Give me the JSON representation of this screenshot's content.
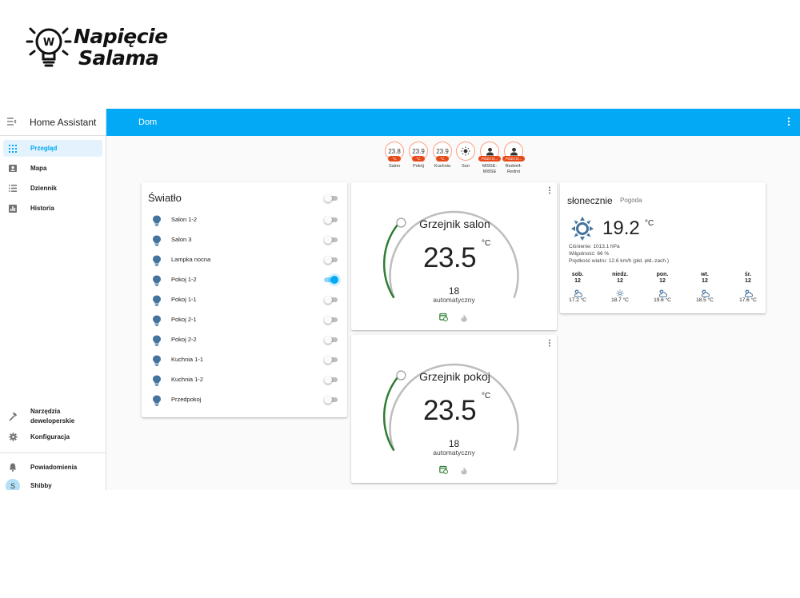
{
  "logo": {
    "line1": "Napięcie",
    "line2": "Salama",
    "mark": "W"
  },
  "sidebar": {
    "title": "Home Assistant",
    "items": [
      {
        "label": "Przegląd",
        "icon": "grid-icon",
        "active": true
      },
      {
        "label": "Mapa",
        "icon": "map-icon"
      },
      {
        "label": "Dziennik",
        "icon": "list-icon"
      },
      {
        "label": "Historia",
        "icon": "chart-icon"
      }
    ],
    "bottom": [
      {
        "label": "Narzędzia",
        "label2": "deweloperskie",
        "icon": "hammer-icon"
      },
      {
        "label": "Konfiguracja",
        "icon": "gear-icon"
      },
      {
        "label": "Powiadomienia",
        "icon": "bell-icon"
      }
    ],
    "user": {
      "initial": "S",
      "name": "Shibby"
    }
  },
  "header": {
    "title": "Dom"
  },
  "badges": [
    {
      "value": "23.8",
      "unit": "°C",
      "name": "Salon"
    },
    {
      "value": "23.9",
      "unit": "°C",
      "name": "Pokój"
    },
    {
      "value": "23.9",
      "unit": "°C",
      "name": "Kuchnia"
    },
    {
      "name": "Sun",
      "icon": "sun-icon"
    },
    {
      "unit": "POZA D...",
      "name": "MI9SE-",
      "name2": "MI9SE",
      "icon": "person-icon"
    },
    {
      "unit": "POZA D...",
      "name": "Redmi4-",
      "name2": "Redmi",
      "icon": "person-icon"
    }
  ],
  "lights": {
    "title": "Światło",
    "master_on": false,
    "items": [
      {
        "name": "Salon 1-2",
        "on": false
      },
      {
        "name": "Salon 3",
        "on": false
      },
      {
        "name": "Lampka nocna",
        "on": false
      },
      {
        "name": "Pokoj 1-2",
        "on": true
      },
      {
        "name": "Pokoj 1-1",
        "on": false
      },
      {
        "name": "Pokoj 2-1",
        "on": false
      },
      {
        "name": "Pokoj 2-2",
        "on": false
      },
      {
        "name": "Kuchnia 1-1",
        "on": false
      },
      {
        "name": "Kuchnia 1-2",
        "on": false
      },
      {
        "name": "Przedpokoj",
        "on": false
      }
    ]
  },
  "thermostats": [
    {
      "name": "Grzejnik salon",
      "temp": "23.5",
      "unit": "°C",
      "target": "18",
      "mode": "automatyczny"
    },
    {
      "name": "Grzejnik pokoj",
      "temp": "23.5",
      "unit": "°C",
      "target": "18",
      "mode": "automatyczny"
    }
  ],
  "weather": {
    "state": "słonecznie",
    "name": "Pogoda",
    "temp": "19.2",
    "unit": "°C",
    "pressure": "Ciśnienie: 1013.1 hPa",
    "humidity": "Wilgotność: 66 %",
    "wind": "Prędkość wiatru: 12.6 km/h (płd. płd.-zach.)",
    "forecast": [
      {
        "day": "sob.",
        "date": "12",
        "temp": "17.2 °C",
        "icon": "partly-cloudy-icon"
      },
      {
        "day": "niedz.",
        "date": "12",
        "temp": "18.7 °C",
        "icon": "sunny-icon"
      },
      {
        "day": "pon.",
        "date": "12",
        "temp": "19.6 °C",
        "icon": "partly-cloudy-icon"
      },
      {
        "day": "wt.",
        "date": "12",
        "temp": "18.5 °C",
        "icon": "partly-cloudy-icon"
      },
      {
        "day": "śr.",
        "date": "12",
        "temp": "17.6 °C",
        "icon": "partly-cloudy-icon"
      }
    ]
  },
  "colors": {
    "accent": "#03a9f4",
    "badge_border": "#ff9e80",
    "badge_label": "#e64a19",
    "heat_arc": "#2e7d32",
    "bulb": "#44739e"
  }
}
